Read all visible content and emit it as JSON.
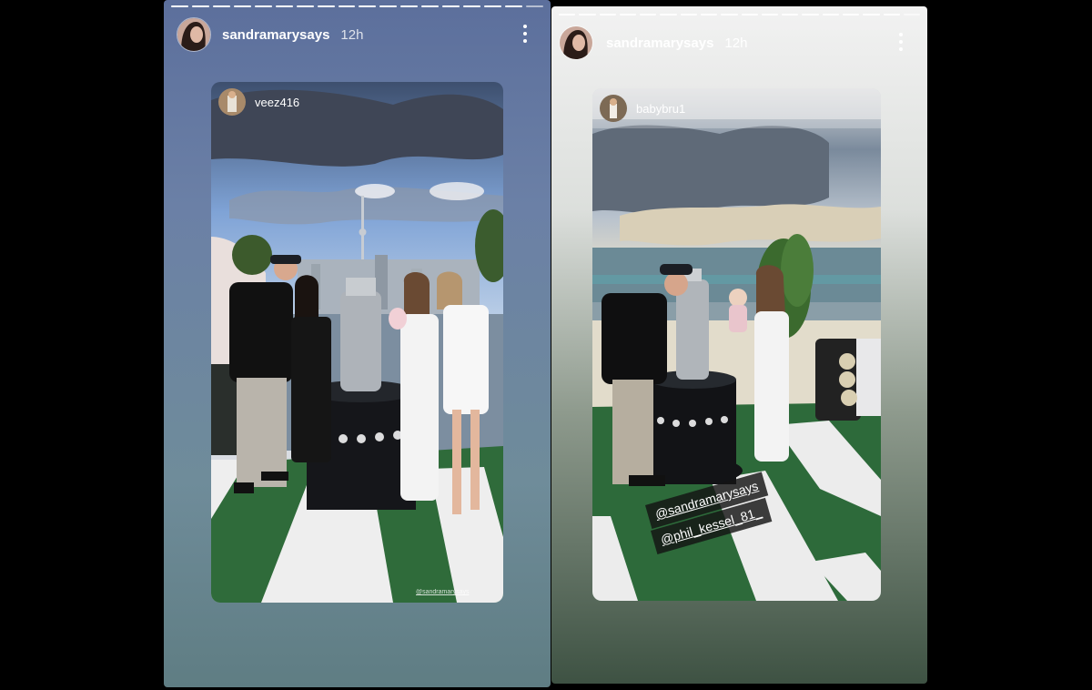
{
  "stories": [
    {
      "author": "sandramarysays",
      "time_ago": "12h",
      "progress_segments": 18,
      "progress_done": 17,
      "reshared_from": "veez416",
      "credit": "@sandramarysays"
    },
    {
      "author": "sandramarysays",
      "time_ago": "12h",
      "progress_segments": 18,
      "progress_done": 17,
      "reshared_from": "babybru1",
      "mentions": [
        "@sandramarysays",
        "@phil_kessel_81_"
      ]
    }
  ],
  "icons": {
    "more": "more-vertical-icon"
  },
  "colors": {
    "left_bg": "#6b80a6",
    "right_bg_top": "#f2f2f2",
    "right_bg_bottom": "#3e5243"
  }
}
